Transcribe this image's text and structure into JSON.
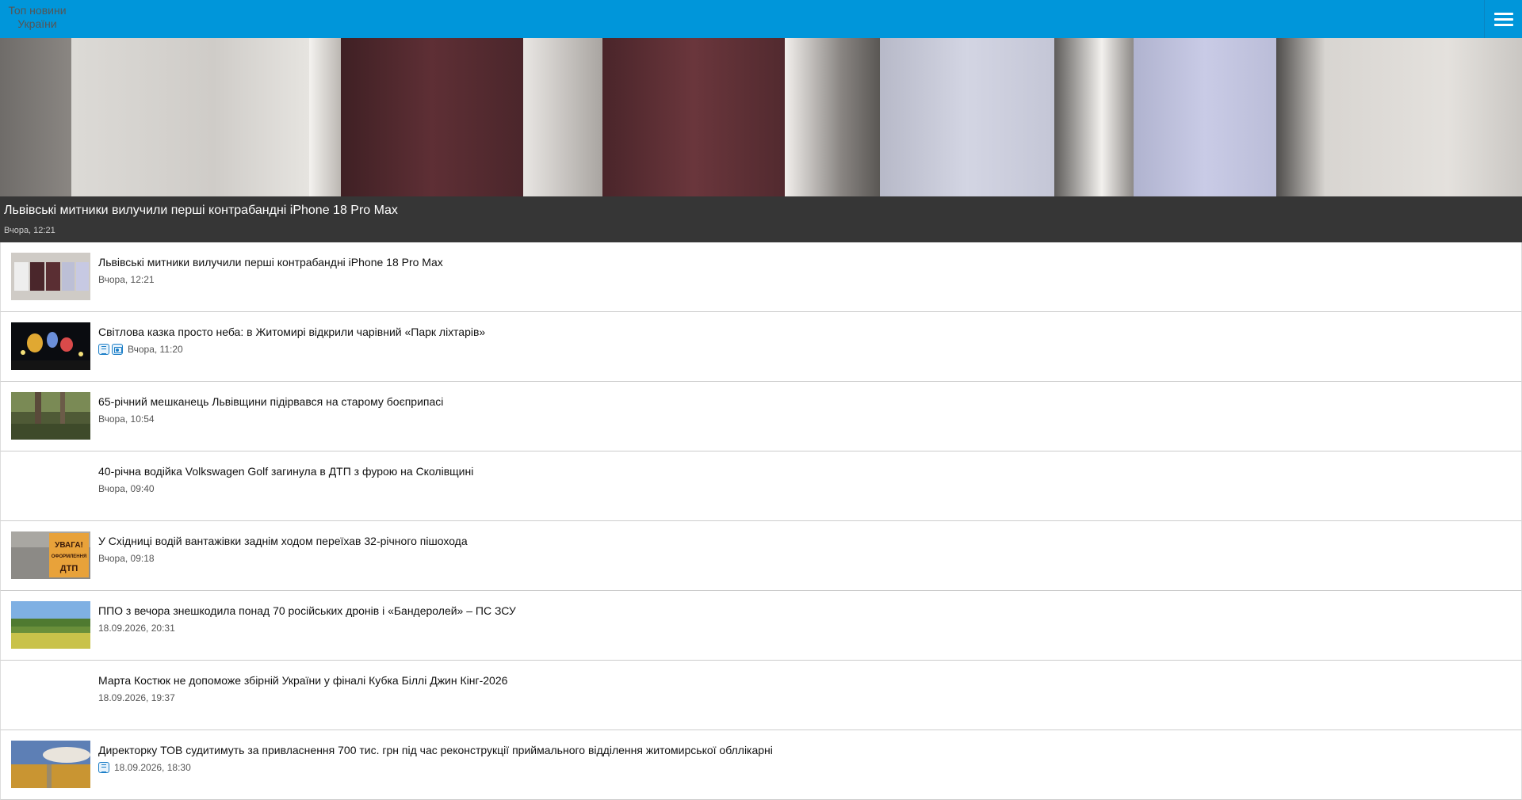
{
  "header": {
    "logo_text": "Топ новини України",
    "menu_icon": "hamburger-menu-icon",
    "bg_color": "#0096da"
  },
  "featured": {
    "title": "Львівські митники вилучили перші контрабандні iPhone 18 Pro Max",
    "date": "Вчора, 12:21"
  },
  "news": [
    {
      "title": "Львівські митники вилучили перші контрабандні iPhone 18 Pro Max",
      "date": "Вчора, 12:21",
      "thumb": "phones",
      "badges": []
    },
    {
      "title": "Світлова казка просто неба: в Житомирі відкрили чарівний «Парк ліхтарів»",
      "date": "Вчора, 11:20",
      "thumb": "lanterns",
      "badges": [
        "text-icon",
        "photo-icon"
      ]
    },
    {
      "title": "65-річний мешканець Львівщини підірвався на старому боєприпасі",
      "date": "Вчора, 10:54",
      "thumb": "forest",
      "badges": []
    },
    {
      "title": "40-річна водійка Volkswagen Golf загинула в ДТП з фурою на Сколівщині",
      "date": "Вчора, 09:40",
      "thumb": "none",
      "badges": []
    },
    {
      "title": "У Східниці водій вантажівки заднім ходом переїхав 32-річного пішохода",
      "date": "Вчора, 09:18",
      "thumb": "sign",
      "sign_text": [
        "УВАГА!",
        "ОФОРМЛЕННЯ",
        "ДТП"
      ],
      "badges": []
    },
    {
      "title": "ППО з вечора знешкодила понад 70 російських дронів і «Бандеролей» – ПС ЗСУ",
      "date": "18.09.2026, 20:31",
      "thumb": "field",
      "badges": []
    },
    {
      "title": "Марта Костюк не допоможе збірній України у фіналі Кубка Біллі Джин Кінг-2026",
      "date": "18.09.2026, 19:37",
      "thumb": "none",
      "badges": []
    },
    {
      "title": "Директорку ТОВ судитимуть за привласнення 700 тис. грн під час реконструкції приймального відділення житомирської обллікарні",
      "date": "18.09.2026, 18:30",
      "thumb": "wheat",
      "badges": [
        "text-icon"
      ]
    }
  ]
}
